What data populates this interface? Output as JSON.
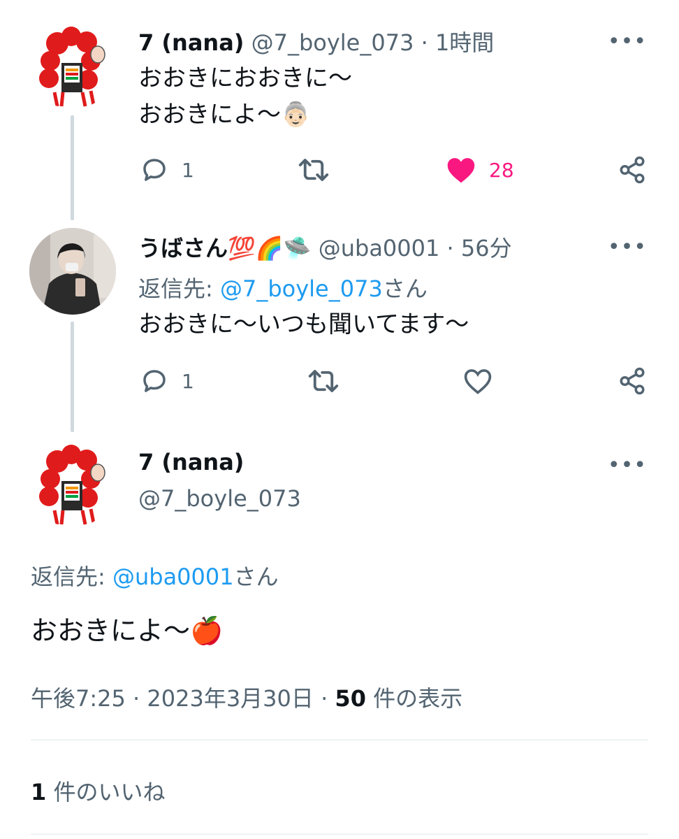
{
  "tweet1": {
    "name": "7 (nana)",
    "handle": "@7_boyle_073",
    "time": "1時間",
    "line1": "おおきにおおきに〜",
    "line2": "おおきによ〜👵🏻",
    "reply_count": "1",
    "like_count": "28"
  },
  "tweet2": {
    "name": "うばさん💯🌈🛸",
    "handle": "@uba0001",
    "time": "56分",
    "reply_prefix": "返信先: ",
    "reply_target": "@7_boyle_073",
    "reply_suffix": "さん",
    "text": "おおきに〜いつも聞いてます〜",
    "reply_count": "1"
  },
  "main_tweet": {
    "name": "7 (nana)",
    "handle": "@7_boyle_073",
    "reply_prefix": "返信先: ",
    "reply_target": "@uba0001",
    "reply_suffix": "さん",
    "text": "おおきによ〜🍎",
    "timestamp": "午後7:25 · 2023年3月30日 · ",
    "views_count": "50",
    "views_label": " 件の表示",
    "likes_count": "1",
    "likes_label": " 件のいいね"
  },
  "colors": {
    "like_active": "#f91880",
    "link": "#1d9bf0",
    "muted": "#536471"
  },
  "separator": "·",
  "more_glyph": "•••"
}
